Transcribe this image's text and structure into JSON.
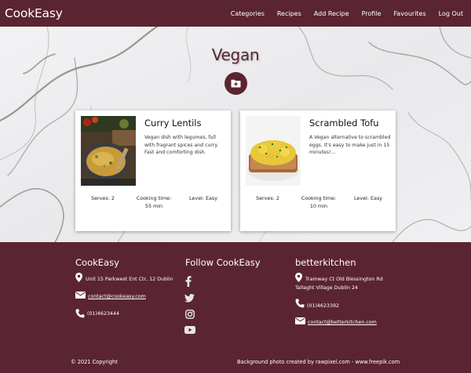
{
  "brand": "CookEasy",
  "nav": {
    "categories": "Categories",
    "recipes": "Recipes",
    "add_recipe": "Add Recipe",
    "profile": "Profile",
    "favourites": "Favourites",
    "logout": "Log Out"
  },
  "category_title": "Vegan",
  "add_button_icon": "folder-plus-icon",
  "recipes": [
    {
      "title": "Curry Lentils",
      "description": "Vegan dish with legumes, full with fragrant spices and curry. Fast and comforting dish.",
      "serves": "Serves: 2",
      "time_label": "Cooking time:",
      "time_value": "55 min",
      "level": "Level: Easy"
    },
    {
      "title": "Scrambled Tofu",
      "description": "A Vegan alternative to scrambled eggs. It's easy to make just in 15 minutes!...",
      "serves": "Serves: 2",
      "time_label": "Cooking time:",
      "time_value": "10 min",
      "level": "Level: Easy"
    }
  ],
  "footer": {
    "col1": {
      "title": "CookEasy",
      "address": "Unit 15 Parkwest Ent Ctr, 12 Dublin",
      "email": "contact@cookeasy.com",
      "phone": "(01)4623444"
    },
    "col2": {
      "title": "Follow CookEasy",
      "icons": [
        "facebook-icon",
        "twitter-icon",
        "instagram-icon",
        "youtube-icon"
      ]
    },
    "col3": {
      "title": "betterkitchen",
      "address_line1": "Tramway Ct Old Blessington Rd",
      "address_line2": "Tallaght Village Dublin 24",
      "phone": "(01)4623392",
      "email": "contact@betterkitchen.com"
    },
    "copyright": "© 2021 Copyright",
    "credit": "Background photo created by rawpixel.com - www.freepik.com"
  },
  "colors": {
    "primary": "#5b2432",
    "card_bg": "#ffffff",
    "hero_bg": "#eeeef0"
  }
}
